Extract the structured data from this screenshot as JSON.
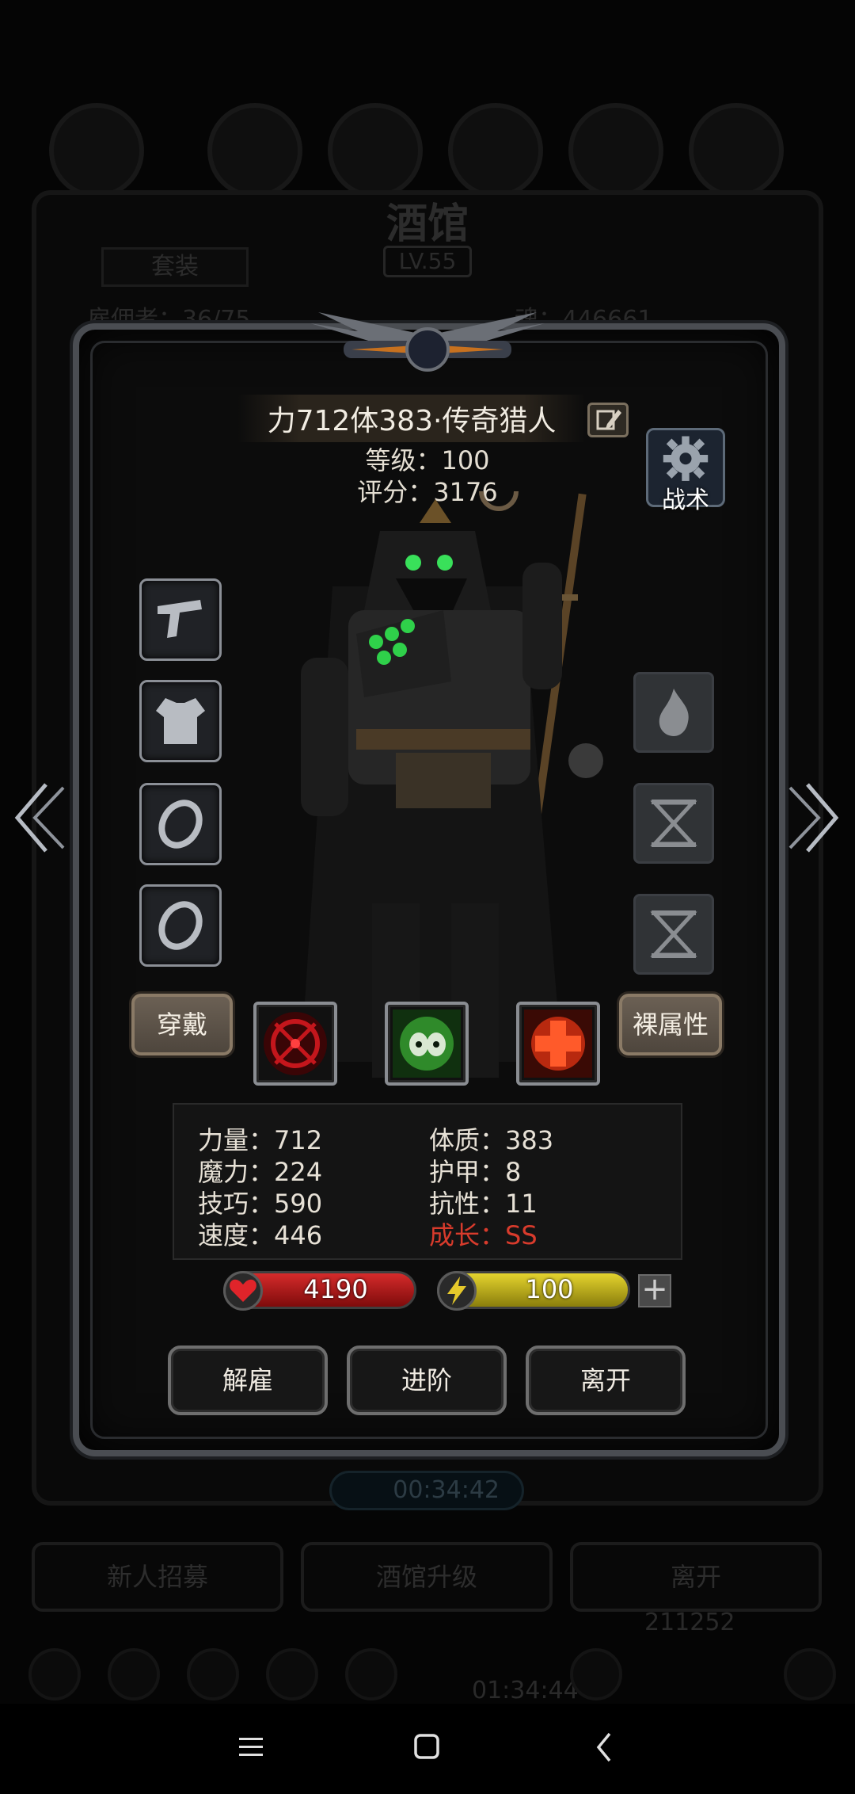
{
  "background": {
    "title": "酒馆",
    "level": "LV.55",
    "tab_label": "套装",
    "recruits_text": "雇佣者：36/75",
    "soul_text": "魂：446661",
    "timer": "00:34:42",
    "bottom_buttons": [
      "新人招募",
      "酒馆升级",
      "离开"
    ],
    "currency_value": "211252",
    "bottom_timer": "01:34:44"
  },
  "hero": {
    "name": "力712体383·传奇猎人",
    "level_text": "等级：100",
    "score_text": "评分：3176",
    "tactics_label": "战术"
  },
  "equipment_slots": [
    {
      "icon": "pistol-icon"
    },
    {
      "icon": "armor-icon"
    },
    {
      "icon": "ring-icon"
    },
    {
      "icon": "ring-icon"
    }
  ],
  "right_slots": [
    {
      "icon": "flame-icon"
    },
    {
      "icon": "hourglass-icon"
    },
    {
      "icon": "hourglass-icon"
    }
  ],
  "buttons": {
    "equip": "穿戴",
    "base_attributes": "裸属性",
    "dismiss": "解雇",
    "advance": "进阶",
    "leave": "离开"
  },
  "skills": [
    {
      "icon": "crosshair-skill-icon",
      "color": "#c4161c"
    },
    {
      "icon": "poison-skull-skill-icon",
      "color": "#41c23b"
    },
    {
      "icon": "heal-cross-skill-icon",
      "color": "#e23a1f"
    }
  ],
  "stats": {
    "left": [
      "力量：712",
      "魔力：224",
      "技巧：590",
      "速度：446"
    ],
    "right": [
      "体质：383",
      "护甲：8",
      "抗性：11"
    ],
    "growth": "成长：SS"
  },
  "hp": "4190",
  "energy": "100",
  "colors": {
    "hp": "#c81f1f",
    "energy": "#d6c82a",
    "growth": "#d83b2c"
  }
}
